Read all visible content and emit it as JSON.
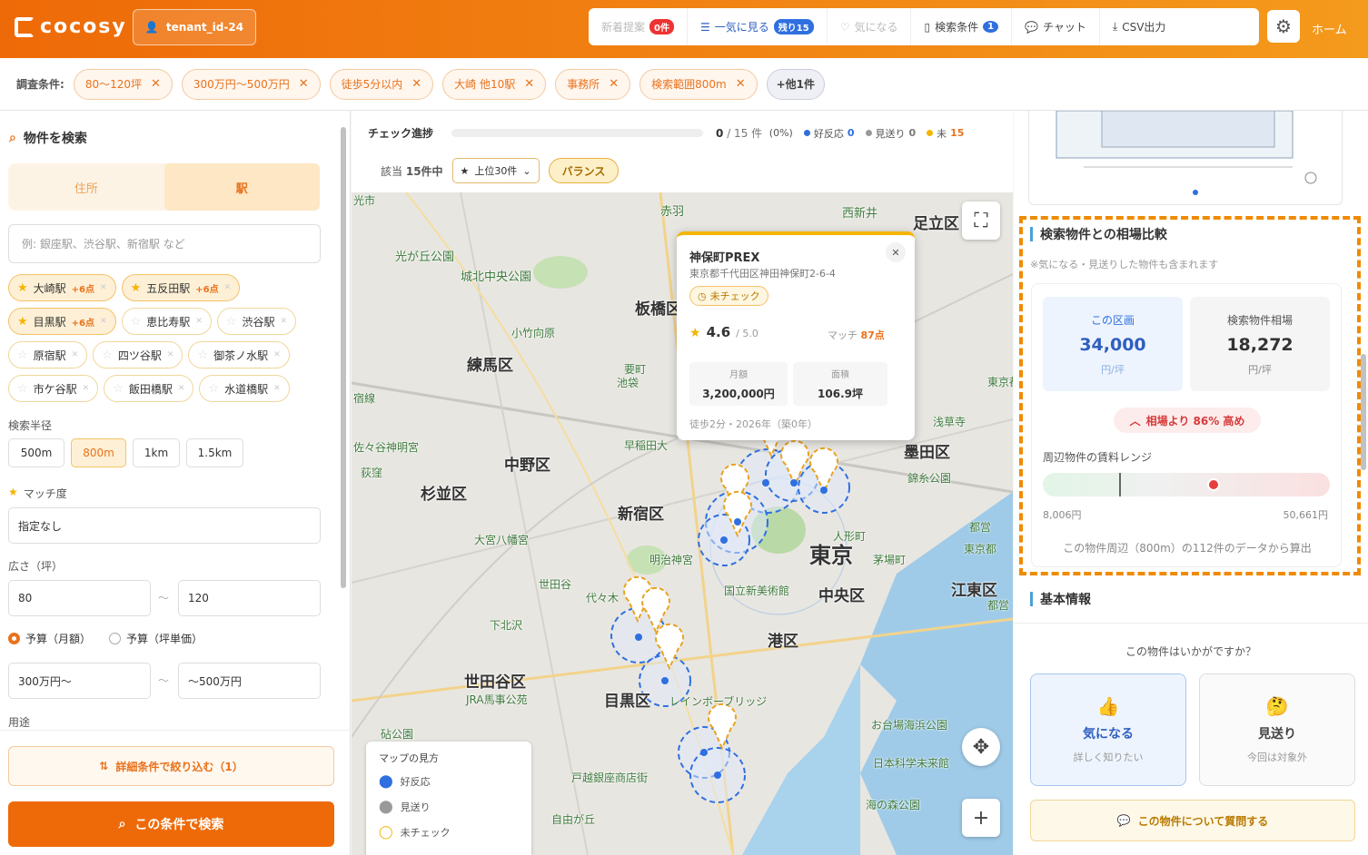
{
  "header": {
    "logo": "cocosy",
    "tenant": "tenant_id-24",
    "new": "新着提案",
    "new_count": "0件",
    "view_all": "一気に見る",
    "remaining": "残り15",
    "favorite": "気になる",
    "search_cond": "検索条件",
    "search_cond_count": "1",
    "chat": "チャット",
    "csv": "CSV出力",
    "home": "ホーム"
  },
  "conditions": {
    "label": "調査条件:",
    "chips": [
      "80〜120坪",
      "300万円〜500万円",
      "徒歩5分以内",
      "大崎 他10駅",
      "事務所",
      "検索範囲800m"
    ],
    "more": "+他1件"
  },
  "left": {
    "title": "物件を検索",
    "tab_address": "住所",
    "tab_station": "駅",
    "search_placeholder": "例: 銀座駅、渋谷駅、新宿駅 など",
    "stations": [
      {
        "name": "大崎駅",
        "plus": "+6点",
        "on": true
      },
      {
        "name": "五反田駅",
        "plus": "+6点",
        "on": true
      },
      {
        "name": "目黒駅",
        "plus": "+6点",
        "on": true
      },
      {
        "name": "恵比寿駅",
        "plus": "",
        "on": false
      },
      {
        "name": "渋谷駅",
        "plus": "",
        "on": false
      },
      {
        "name": "原宿駅",
        "plus": "",
        "on": false
      },
      {
        "name": "四ツ谷駅",
        "plus": "",
        "on": false
      },
      {
        "name": "御茶ノ水駅",
        "plus": "",
        "on": false
      },
      {
        "name": "市ケ谷駅",
        "plus": "",
        "on": false
      },
      {
        "name": "飯田橋駅",
        "plus": "",
        "on": false
      },
      {
        "name": "水道橋駅",
        "plus": "",
        "on": false
      }
    ],
    "radius_label": "検索半径",
    "radii": [
      "500m",
      "800m",
      "1km",
      "1.5km"
    ],
    "match_label": "マッチ度",
    "match_value": "指定なし",
    "area_label": "広さ（坪）",
    "area_min": "80",
    "area_max": "120",
    "budget_month": "予算（月額）",
    "budget_tsubo": "予算（坪単価）",
    "budget_min": "300万円〜",
    "budget_max": "〜500万円",
    "usage_label": "用途",
    "detail_btn": "詳細条件で絞り込む（1）",
    "search_btn": "この条件で検索"
  },
  "mid": {
    "progress_label": "チェック進捗",
    "progress_done": "0",
    "progress_total": "/ 15 件",
    "progress_pct": "(0%)",
    "legend_good": "好反応",
    "legend_good_n": "0",
    "legend_pass": "見送り",
    "legend_pass_n": "0",
    "legend_un": "未",
    "legend_un_n": "15",
    "count_prefix": "該当",
    "count": "15件中",
    "top": "上位30件",
    "balance": "バランス"
  },
  "map": {
    "labels": [
      "赤羽",
      "西新井",
      "足立区",
      "光が丘公園",
      "城北中央公園",
      "板橋区",
      "練馬区",
      "小竹向原",
      "要町",
      "池袋",
      "中野区",
      "杉並区",
      "新宿区",
      "大宮八幡宮",
      "明治神宮",
      "世田谷区",
      "目黒区",
      "港区",
      "中央区",
      "東京",
      "墨田区",
      "江東区",
      "浅草寺",
      "国立新美術館",
      "下北沢",
      "世田谷",
      "JRA馬事公苑",
      "代々木",
      "レインボーブリッジ",
      "お台場海浜公園",
      "日本科学未来館",
      "海の森公園",
      "戸越銀座商店街",
      "自由が丘",
      "早稲田大",
      "荻窪",
      "佐々谷神明宮",
      "錦糸公園",
      "茅場町",
      "人形町",
      "都営",
      "東京都",
      "砧公園",
      "宿線",
      "光市",
      "東京都",
      "都営"
    ],
    "popup": {
      "name": "神保町PREX",
      "addr": "東京都千代田区神田神保町2-6-4",
      "status": "未チェック",
      "rating": "4.6",
      "rating_max": "/ 5.0",
      "match_label": "マッチ",
      "match": "87点",
      "rent_label": "月額",
      "rent": "3,200,000円",
      "area_label": "面積",
      "area": "106.9坪",
      "footer": "徒歩2分・2026年（築0年）"
    },
    "legend_title": "マップの見方",
    "legend": [
      "好反応",
      "見送り",
      "未チェック"
    ]
  },
  "right": {
    "compare_title": "検索物件との相場比較",
    "compare_note": "※気になる・見送りした物件も含まれます",
    "this_label": "この区画",
    "this_value": "34,000",
    "this_unit": "円/坪",
    "avg_label": "検索物件相場",
    "avg_value": "18,272",
    "avg_unit": "円/坪",
    "badge": "相場より 86% 高め",
    "range_label": "周辺物件の賃料レンジ",
    "range_min": "8,006円",
    "range_max": "50,661円",
    "range_note": "この物件周辺（800m）の112件のデータから算出",
    "basic_title": "基本情報",
    "question": "この物件はいかがですか？",
    "fav": "気になる",
    "fav_sub": "詳しく知りたい",
    "pass": "見送り",
    "pass_sub": "今回は対象外",
    "ask": "この物件について質問する"
  },
  "colors": {
    "accent": "#ee6a08",
    "good": "#2f6fe0",
    "pass": "#999999",
    "unchecked": "#f4b400"
  }
}
